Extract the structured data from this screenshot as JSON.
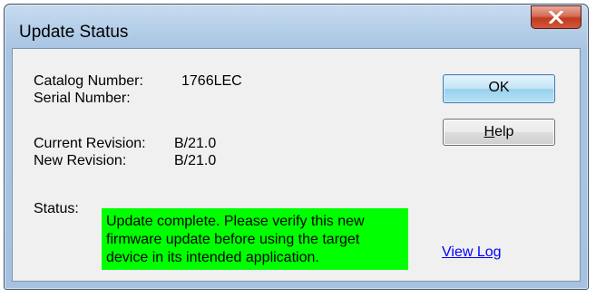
{
  "window": {
    "title": "Update Status",
    "close_icon": "close-icon",
    "accent_color": "#c13a21"
  },
  "info": {
    "catalog_label": "Catalog Number:",
    "catalog_value": "1766LEC",
    "serial_label": "Serial Number:",
    "serial_value": "",
    "current_revision_label": "Current Revision:",
    "current_revision_value": "B/21.0",
    "new_revision_label": "New Revision:",
    "new_revision_value": "B/21.0"
  },
  "status": {
    "label": "Status:",
    "lines": [
      "Update complete. Please verify this new",
      "firmware update before using the target",
      "device in its intended application."
    ],
    "background_color": "#00ff00"
  },
  "buttons": {
    "ok_label": "OK",
    "help_prefix": "",
    "help_mnemonic": "H",
    "help_suffix": "elp"
  },
  "links": {
    "view_log": "View Log"
  }
}
